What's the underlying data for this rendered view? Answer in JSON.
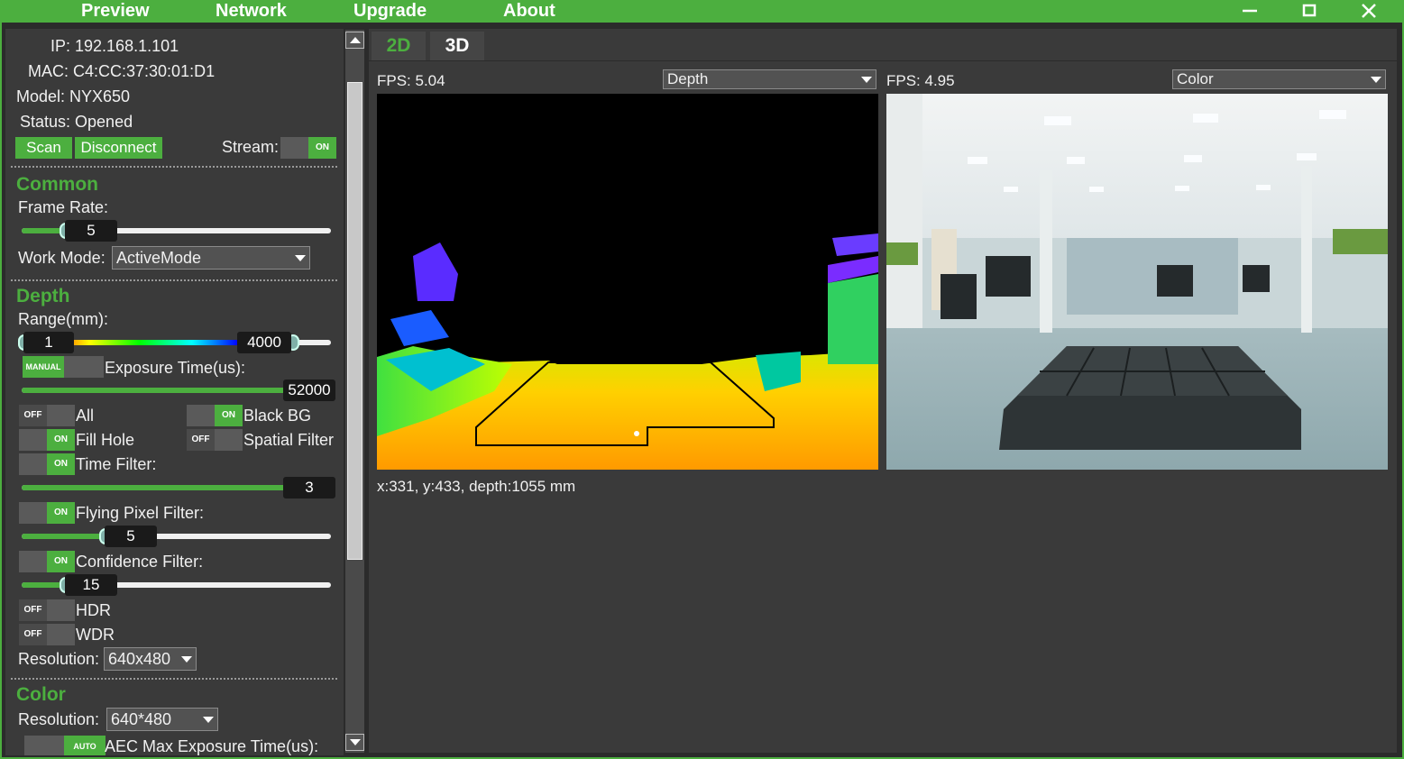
{
  "menu": [
    "Preview",
    "Network",
    "Upgrade",
    "About"
  ],
  "window_controls": {
    "minimize": "—",
    "maximize": "☐",
    "close": "✕"
  },
  "device": {
    "ip": "IP: 192.168.1.101",
    "mac": "MAC: C4:CC:37:30:01:D1",
    "model": "Model: NYX650",
    "status": "Status: Opened",
    "scan_label": "Scan",
    "disconnect_label": "Disconnect",
    "stream_label": "Stream:",
    "stream_state": "ON"
  },
  "common": {
    "title": "Common",
    "frame_rate_label": "Frame Rate:",
    "frame_rate_value": "5",
    "work_mode_label": "Work Mode:",
    "work_mode_value": "ActiveMode"
  },
  "depth": {
    "title": "Depth",
    "range_label": "Range(mm):",
    "range_min": "1",
    "range_max": "4000",
    "exposure_mode": "MANUAL",
    "exposure_label": "Exposure Time(us):",
    "exposure_value": "52000",
    "all_state": "OFF",
    "all_label": "All",
    "black_bg_state": "ON",
    "black_bg_label": "Black BG",
    "fill_hole_state": "ON",
    "fill_hole_label": "Fill Hole",
    "spatial_state": "OFF",
    "spatial_label": "Spatial Filter",
    "time_filter_state": "ON",
    "time_filter_label": "Time Filter:",
    "time_filter_value": "3",
    "flying_state": "ON",
    "flying_label": "Flying Pixel Filter:",
    "flying_value": "5",
    "confidence_state": "ON",
    "confidence_label": "Confidence Filter:",
    "confidence_value": "15",
    "hdr_state": "OFF",
    "hdr_label": "HDR",
    "wdr_state": "OFF",
    "wdr_label": "WDR",
    "resolution_label": "Resolution:",
    "resolution_value": "640x480"
  },
  "color": {
    "title": "Color",
    "resolution_label": "Resolution:",
    "resolution_value": "640*480",
    "aec_state": "AUTO",
    "aec_label": "AEC Max Exposure Time(us):"
  },
  "tabs": [
    "2D",
    "3D"
  ],
  "left_view": {
    "fps": "FPS: 5.04",
    "mode": "Depth"
  },
  "right_view": {
    "fps": "FPS: 4.95",
    "mode": "Color"
  },
  "cursor_info": "x:331, y:433, depth:1055 mm",
  "colors": {
    "accent": "#4caf3f",
    "panel": "#3a3a3a",
    "dark": "#2b2b2b"
  }
}
